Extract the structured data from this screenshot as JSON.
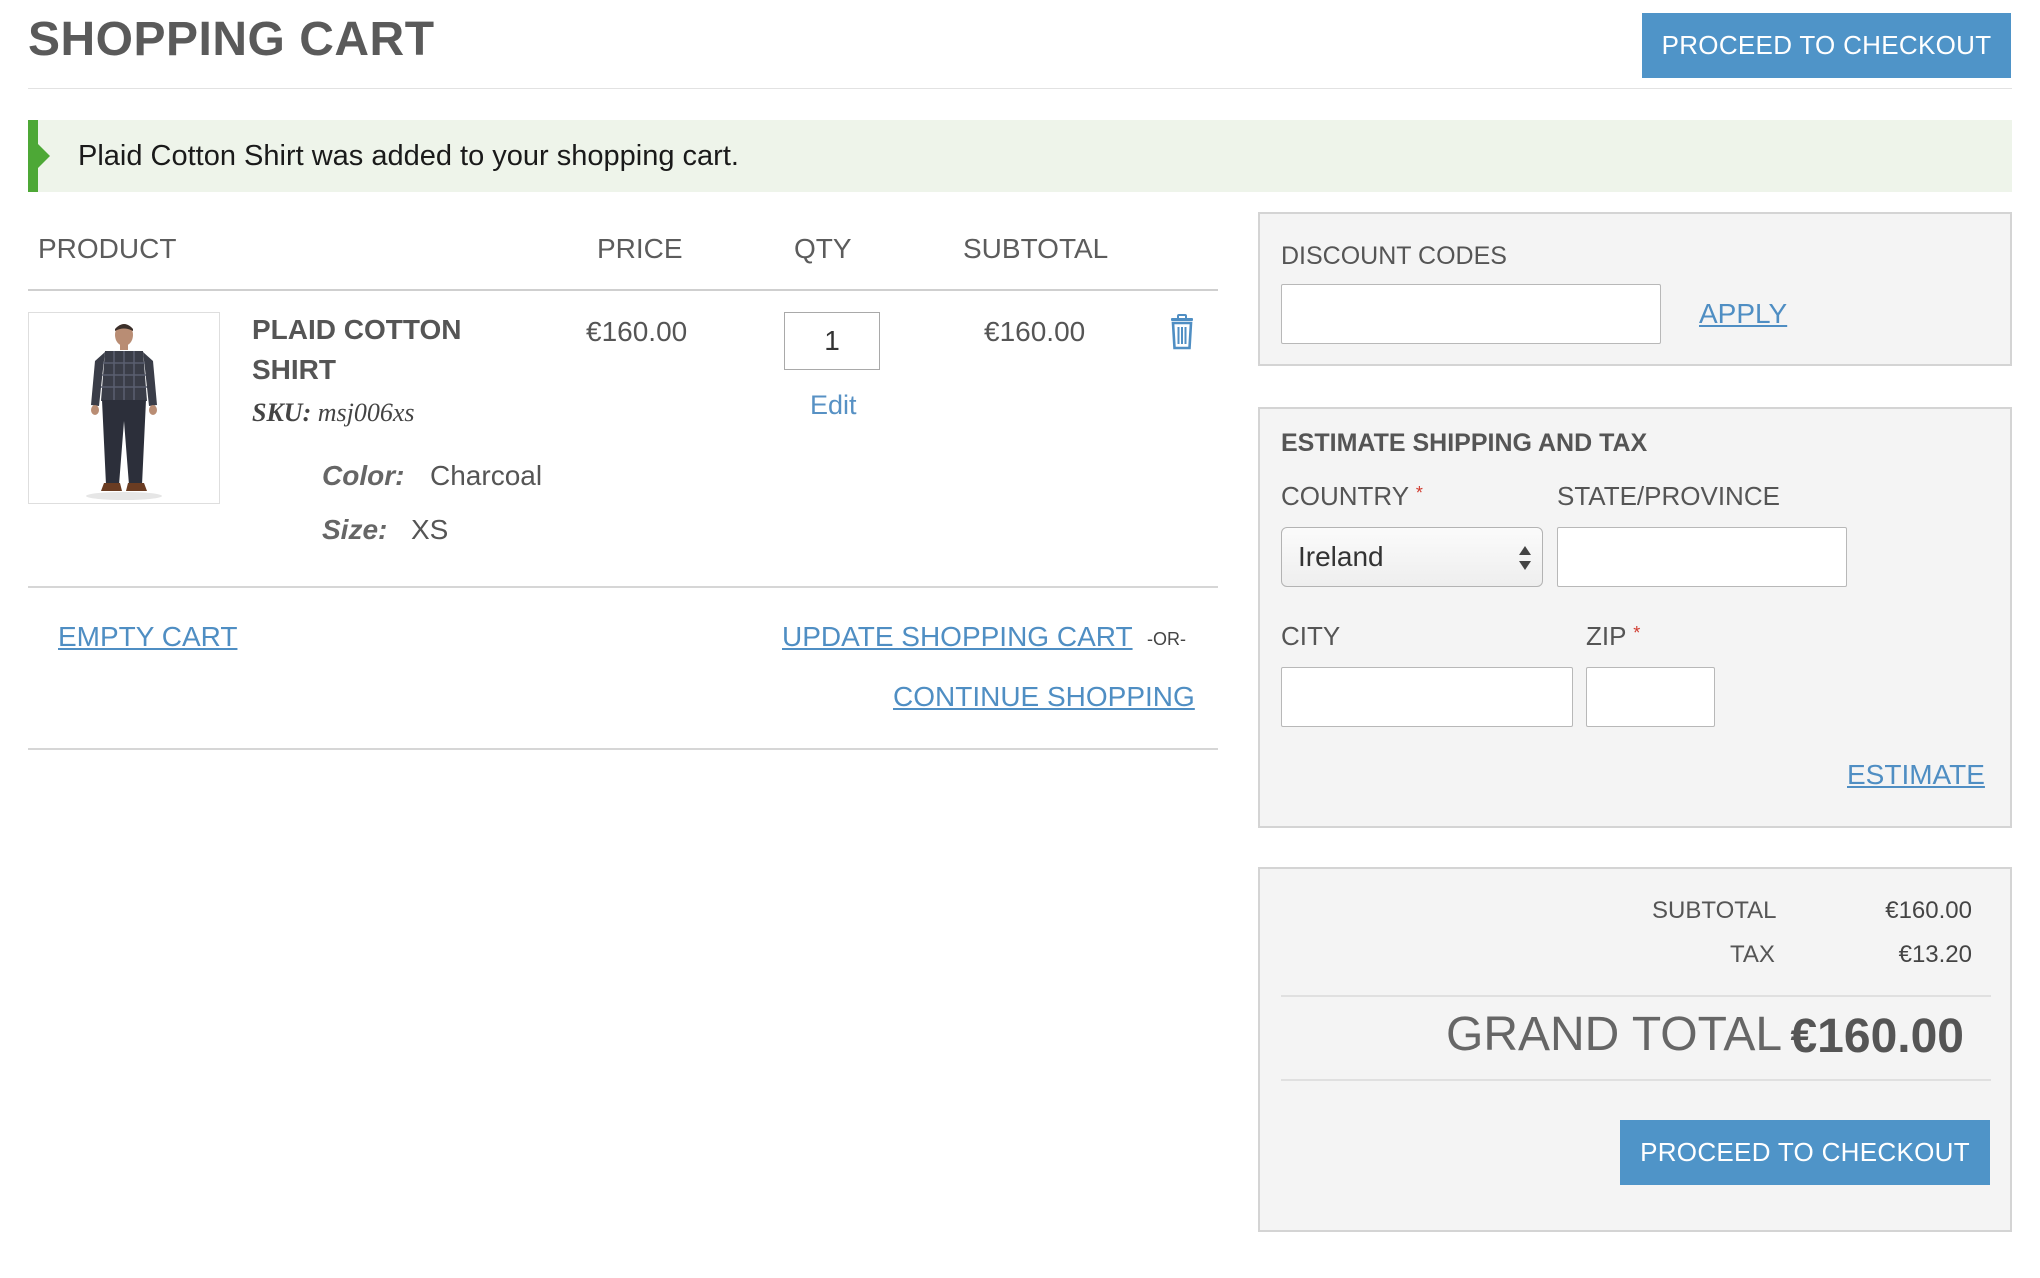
{
  "page_title": "SHOPPING CART",
  "checkout_label": "PROCEED TO CHECKOUT",
  "notice": "Plaid Cotton Shirt was added to your shopping cart.",
  "table": {
    "headers": [
      "PRODUCT",
      "PRICE",
      "QTY",
      "SUBTOTAL"
    ],
    "item": {
      "name_line1": "PLAID COTTON",
      "name_line2": "SHIRT",
      "sku_label": "SKU:",
      "sku": "msj006xs",
      "options": [
        {
          "label": "Color:",
          "value": "Charcoal"
        },
        {
          "label": "Size:",
          "value": "XS"
        }
      ],
      "price": "€160.00",
      "qty": "1",
      "edit_label": "Edit",
      "subtotal": "€160.00"
    }
  },
  "actions": {
    "empty_cart": "EMPTY CART",
    "update_cart": "UPDATE SHOPPING CART",
    "or": "-OR-",
    "continue": "CONTINUE SHOPPING"
  },
  "discount": {
    "title": "DISCOUNT CODES",
    "apply": "APPLY",
    "value": ""
  },
  "shipping": {
    "title": "ESTIMATE SHIPPING AND TAX",
    "country_label": "COUNTRY",
    "country_value": "Ireland",
    "state_label": "STATE/PROVINCE",
    "city_label": "CITY",
    "zip_label": "ZIP",
    "required_mark": "*",
    "estimate": "ESTIMATE"
  },
  "summary": {
    "subtotal_label": "SUBTOTAL",
    "subtotal_value": "€160.00",
    "tax_label": "TAX",
    "tax_value": "€13.20",
    "grand_label": "GRAND TOTAL",
    "grand_value": "€160.00"
  },
  "colors": {
    "accent": "#4f94c8",
    "success": "#4da836",
    "link": "#4f8ec3",
    "required": "#d03a2e"
  },
  "icons": {
    "remove": "trash-icon",
    "select": "select-arrows-icon",
    "notice": "caret-right-icon"
  }
}
